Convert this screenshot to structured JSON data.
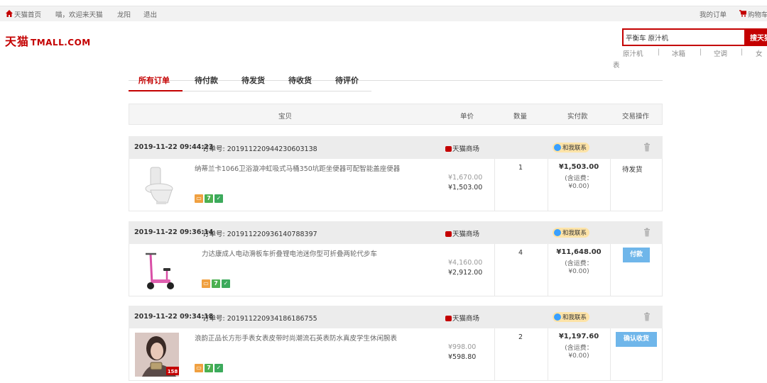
{
  "topbar": {
    "home": "天猫首页",
    "welcome": "喵，欢迎来天猫",
    "user": "龙阳",
    "logout": "退出",
    "my_orders": "我的订单",
    "cart": "购物车"
  },
  "logo": {
    "cn": "天猫",
    "en": "TMALL.COM"
  },
  "search": {
    "value": "平衡车 原汁机",
    "button": "搜天猫",
    "hotwords": [
      "原汁机",
      "冰箱",
      "空调",
      "女",
      "表"
    ]
  },
  "tabs": [
    "所有订单",
    "待付款",
    "待发货",
    "待收货",
    "待评价"
  ],
  "columns": {
    "item": "宝贝",
    "unit_price": "单价",
    "quantity": "数量",
    "paid": "实付款",
    "action": "交易操作"
  },
  "order_labels": {
    "order_no_prefix": "订单号:",
    "contact": "和我联系",
    "shipping_label": "(含运费：",
    "shipping_value": "¥0.00)"
  },
  "orders": [
    {
      "date": "2019-11-22 09:44:23",
      "number": "201911220944230603138",
      "shop": "天猫商场",
      "title": "纳蒂兰卡1066卫浴漩冲虹吸式马桶350坑距坐便器可配智能盖座便器",
      "original_price": "¥1,670.00",
      "price": "¥1,503.00",
      "quantity": "1",
      "paid": "¥1,503.00",
      "status": "待发货"
    },
    {
      "date": "2019-11-22 09:36:14",
      "number": "201911220936140788397",
      "shop": "天猫商场",
      "title": "力达康成人电动滑板车折叠锂电池迷你型可折叠两轮代步车",
      "original_price": "¥4,160.00",
      "price": "¥2,912.00",
      "quantity": "4",
      "paid": "¥11,648.00",
      "button": "付款"
    },
    {
      "date": "2019-11-22 09:34:18",
      "number": "201911220934186186755",
      "shop": "天猫商场",
      "title": "浪韵正品长方形手表女表皮带时尚潮流石英表防水真皮学生休闲腕表",
      "original_price": "¥998.00",
      "price": "¥598.80",
      "quantity": "2",
      "paid": "¥1,197.60",
      "button": "确认收货",
      "image_badge": "158"
    }
  ],
  "colors": {
    "accent": "#c40000",
    "button": "#6fb6ea"
  }
}
